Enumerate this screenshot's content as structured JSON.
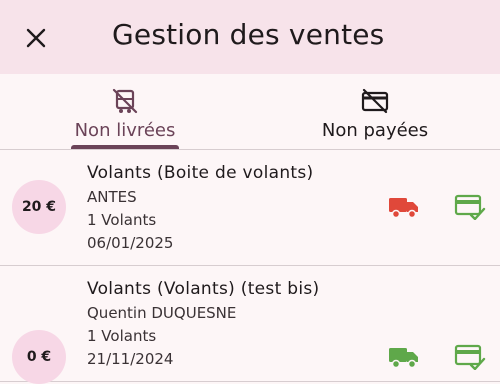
{
  "header": {
    "title": "Gestion des ventes",
    "close_icon": "close-icon"
  },
  "tabs": [
    {
      "label": "Non livrées",
      "icon": "no-delivery-truck-icon",
      "active": true
    },
    {
      "label": "Non payées",
      "icon": "no-card-icon",
      "active": false
    }
  ],
  "colors": {
    "appbar": "#f7e3ea",
    "accent": "#6b4358",
    "price_badge": "#f7d7e6",
    "status_red": "#e0483a",
    "status_green": "#5fa84a"
  },
  "sales": [
    {
      "price": "20 €",
      "title": "Volants (Boite de volants)",
      "client": " ANTES",
      "quantity": "1 Volants",
      "date": "06/01/2025",
      "delivery_icon": "truck-icon",
      "delivery_status": "not-delivered",
      "payment_icon": "card-check-icon",
      "payment_status": "paid"
    },
    {
      "price": "0 €",
      "title": "Volants (Volants) (test bis)",
      "client": "Quentin DUQUESNE",
      "quantity": "1 Volants",
      "date": "21/11/2024",
      "delivery_icon": "truck-icon",
      "delivery_status": "delivered",
      "payment_icon": "card-check-icon",
      "payment_status": "paid"
    }
  ]
}
